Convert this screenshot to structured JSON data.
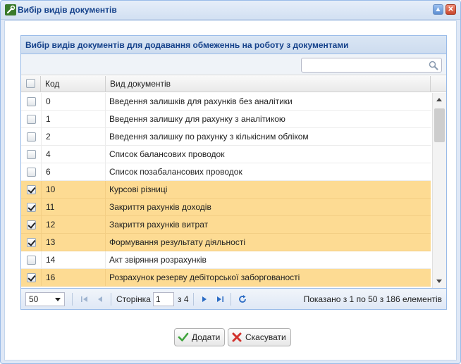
{
  "window": {
    "title": "Вибір видів документів",
    "minimize_label": "▲",
    "close_label": "✕"
  },
  "grid": {
    "title": "Вибір видів документів для додавання обмеженнь на роботу з документами",
    "search": {
      "value": "",
      "placeholder": ""
    },
    "columns": {
      "code": "Код",
      "type": "Вид документів"
    },
    "rows": [
      {
        "checked": false,
        "code": "0",
        "name": "Введення залишків для рахунків без аналітики"
      },
      {
        "checked": false,
        "code": "1",
        "name": "Введення залишку для рахунку з аналітикою"
      },
      {
        "checked": false,
        "code": "2",
        "name": "Введення залишку по рахунку з кількісним обліком"
      },
      {
        "checked": false,
        "code": "4",
        "name": "Список балансових проводок"
      },
      {
        "checked": false,
        "code": "6",
        "name": "Список позабалансових проводок"
      },
      {
        "checked": true,
        "code": "10",
        "name": "Курсові різниці"
      },
      {
        "checked": true,
        "code": "11",
        "name": "Закриття рахунків доходів"
      },
      {
        "checked": true,
        "code": "12",
        "name": "Закриття рахунків витрат"
      },
      {
        "checked": true,
        "code": "13",
        "name": "Формування результату діяльності"
      },
      {
        "checked": false,
        "code": "14",
        "name": "Акт звіряння розрахунків"
      },
      {
        "checked": true,
        "code": "16",
        "name": "Розрахунок резерву дебіторської заборгованості"
      }
    ]
  },
  "pager": {
    "page_size": "50",
    "page_label": "Сторінка",
    "page_value": "1",
    "of_label": "з 4",
    "info": "Показано з 1 по 50 з 186 елементів"
  },
  "buttons": {
    "add": "Додати",
    "cancel": "Скасувати"
  },
  "colors": {
    "selected_row": "#fddb93",
    "header_text": "#15428b",
    "border": "#99bbe8"
  }
}
